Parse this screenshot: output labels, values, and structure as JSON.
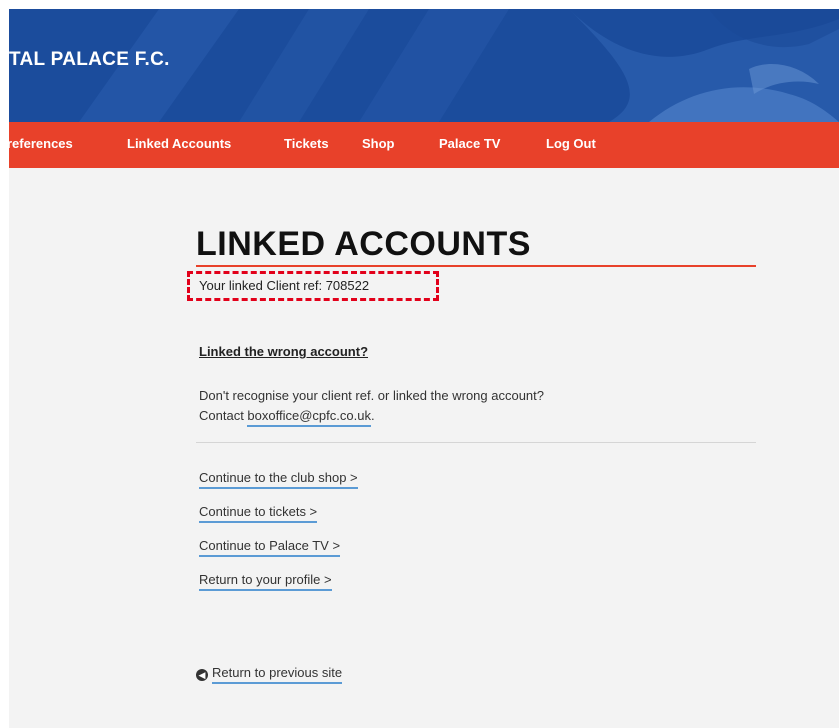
{
  "header": {
    "club_name": "TAL PALACE F.C.",
    "colors": {
      "blue": "#1b4c9c",
      "red": "#e8412a"
    }
  },
  "nav": {
    "items": [
      {
        "label": "references"
      },
      {
        "label": "Linked Accounts"
      },
      {
        "label": "Tickets"
      },
      {
        "label": "Shop"
      },
      {
        "label": "Palace TV"
      },
      {
        "label": "Log Out"
      }
    ]
  },
  "main": {
    "title": "LINKED ACCOUNTS",
    "client_ref_text": "Your linked Client ref: 708522",
    "wrong_account_heading": "Linked the wrong account?",
    "help_line1": "Don't recognise your client ref. or linked the wrong account?",
    "help_contact_prefix": "Contact ",
    "help_email": "boxoffice@cpfc.co.uk",
    "help_suffix": ".",
    "links": [
      {
        "label": "Continue to the club shop >"
      },
      {
        "label": "Continue to tickets >"
      },
      {
        "label": "Continue to Palace TV >"
      },
      {
        "label": "Return to your profile >"
      }
    ],
    "previous_site_label": "Return to previous site"
  }
}
